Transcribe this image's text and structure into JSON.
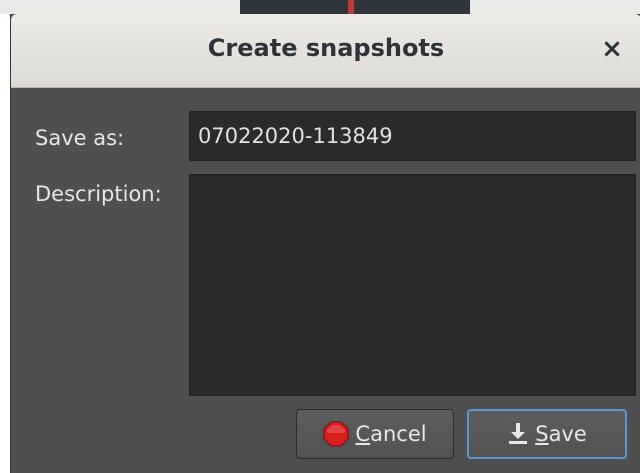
{
  "dialog": {
    "title": "Create snapshots",
    "close_label": "×"
  },
  "form": {
    "save_as_label": "Save as:",
    "save_as_value": "07022020-113849",
    "description_label": "Description:",
    "description_value": ""
  },
  "buttons": {
    "cancel_first": "C",
    "cancel_rest": "ancel",
    "save_first": "S",
    "save_rest": "ave"
  },
  "icons": {
    "cancel": "stop-icon",
    "save": "download-icon"
  },
  "colors": {
    "stop_red": "#d81e1e",
    "focus_blue": "#5a95d6"
  }
}
